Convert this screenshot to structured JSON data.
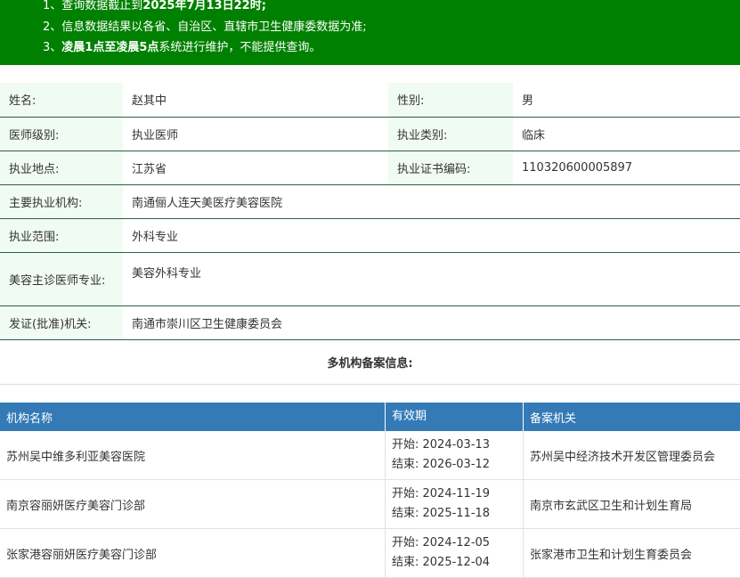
{
  "notice": {
    "line1_prefix": "1、查询数据截止到",
    "line1_bold": "2025年7月13日22时;",
    "line2": "2、信息数据结果以各省、自治区、直辖市卫生健康委数据为准;",
    "line3_prefix": "3、",
    "line3_bold": "凌晨1点至凌晨5点",
    "line3_suffix": "系统进行维护，不能提供查询。"
  },
  "doctor": {
    "name_label": "姓名:",
    "name": "赵其中",
    "gender_label": "性别:",
    "gender": "男",
    "level_label": "医师级别:",
    "level": "执业医师",
    "type_label": "执业类别:",
    "type": "临床",
    "place_label": "执业地点:",
    "place": "江苏省",
    "cert_label": "执业证书编码:",
    "cert": "110320600005897",
    "org_label": "主要执业机构:",
    "org": "南通俪人连天美医疗美容医院",
    "scope_label": "执业范围:",
    "scope": "外科专业",
    "cosmetic_label": "美容主诊医师专业:",
    "cosmetic": "美容外科专业",
    "issuer_label": "发证(批准)机关:",
    "issuer": "南通市崇川区卫生健康委员会"
  },
  "multi": {
    "title": "多机构备案信息:",
    "headers": [
      "机构名称",
      "有效期",
      "备案机关"
    ],
    "rows": [
      {
        "name": "苏州吴中维多利亚美容医院",
        "start": "开始:  2024-03-13",
        "end": "结束:  2026-03-12",
        "authority": "苏州吴中经济技术开发区管理委员会"
      },
      {
        "name": "南京容丽妍医疗美容门诊部",
        "start": "开始:  2024-11-19",
        "end": "结束:  2025-11-18",
        "authority": "南京市玄武区卫生和计划生育局"
      },
      {
        "name": "张家港容丽妍医疗美容门诊部",
        "start": "开始:  2024-12-05",
        "end": "结束:  2025-12-04",
        "authority": "张家港市卫生和计划生育委员会"
      }
    ]
  },
  "colors": {
    "notice_bg": "#008000",
    "header_bg": "#337ab7",
    "label_bg": "#f0fbf4"
  }
}
